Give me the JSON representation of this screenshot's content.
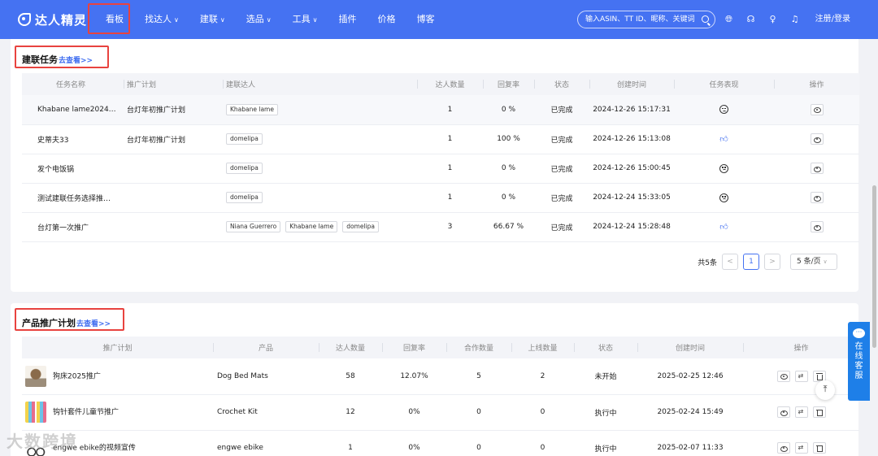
{
  "nav": {
    "logo": "达人精灵",
    "items": [
      {
        "label": "看板",
        "caret": false
      },
      {
        "label": "找达人",
        "caret": true
      },
      {
        "label": "建联",
        "caret": true
      },
      {
        "label": "选品",
        "caret": true
      },
      {
        "label": "工具",
        "caret": true
      },
      {
        "label": "插件",
        "caret": false
      },
      {
        "label": "价格",
        "caret": false
      },
      {
        "label": "博客",
        "caret": false
      }
    ],
    "search_placeholder": "输入ASIN、TT ID、昵称、关键词",
    "login": "注册/登录"
  },
  "outreach": {
    "title": "建联任务",
    "more": "去查看>>",
    "columns": [
      "任务名称",
      "推广计划",
      "建联达人",
      "达人数量",
      "回复率",
      "状态",
      "创建时间",
      "任务表现",
      "操作"
    ],
    "rows": [
      {
        "name": "Khabane lame2024…",
        "plan": "台灯年初推广计划",
        "tags": [
          "Khabane lame"
        ],
        "count": "1",
        "reply": "0 %",
        "status": "已完成",
        "created": "2024-12-26 15:17:31",
        "perf": "sad"
      },
      {
        "name": "史蒂夫33",
        "plan": "台灯年初推广计划",
        "tags": [
          "domelipa"
        ],
        "count": "1",
        "reply": "100 %",
        "status": "已完成",
        "created": "2024-12-26 15:13:08",
        "perf": "thumb"
      },
      {
        "name": "发个电饭锅",
        "plan": "",
        "tags": [
          "domelipa"
        ],
        "count": "1",
        "reply": "0 %",
        "status": "已完成",
        "created": "2024-12-26 15:00:45",
        "perf": "sad"
      },
      {
        "name": "测试建联任务选择推…",
        "plan": "",
        "tags": [
          "domelipa"
        ],
        "count": "1",
        "reply": "0 %",
        "status": "已完成",
        "created": "2024-12-24 15:33:05",
        "perf": "sad"
      },
      {
        "name": "台灯第一次推广",
        "plan": "",
        "tags": [
          "Niana Guerrero",
          "Khabane lame",
          "domelipa"
        ],
        "count": "3",
        "reply": "66.67 %",
        "status": "已完成",
        "created": "2024-12-24 15:28:48",
        "perf": "thumb"
      }
    ],
    "pager": {
      "total": "共5条",
      "prev": "<",
      "current": "1",
      "next": ">",
      "size": "5 条/页"
    }
  },
  "campaigns": {
    "title": "产品推广计划",
    "more": "去查看>>",
    "columns": [
      "推广计划",
      "产品",
      "达人数量",
      "回复率",
      "合作数量",
      "上线数量",
      "状态",
      "创建时间",
      "操作"
    ],
    "rows": [
      {
        "img": "img-dog",
        "plan": "狗床2025推广",
        "product": "Dog Bed Mats",
        "count": "58",
        "reply": "12.07%",
        "coop": "5",
        "online": "2",
        "status": "未开始",
        "created": "2025-02-25 12:46"
      },
      {
        "img": "img-kit",
        "plan": "钩针套件儿童节推广",
        "product": "Crochet Kit",
        "count": "12",
        "reply": "0%",
        "coop": "0",
        "online": "0",
        "status": "执行中",
        "created": "2025-02-24 15:49"
      },
      {
        "img": "img-bike",
        "plan": "engwe ebike的视频宣传",
        "product": "engwe ebike",
        "count": "1",
        "reply": "0%",
        "coop": "0",
        "online": "0",
        "status": "执行中",
        "created": "2025-02-07 11:33"
      }
    ]
  },
  "service": {
    "label": "在线客服"
  },
  "watermark": "大数跨境",
  "colors": {
    "primary": "#4572f2",
    "highlight": "#e8433f",
    "service": "#1e7fe8"
  }
}
